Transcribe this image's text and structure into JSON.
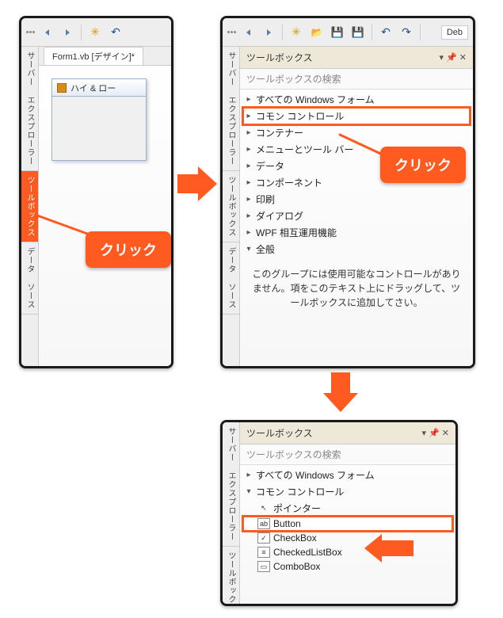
{
  "panel1": {
    "doc_tab": "Form1.vb [デザイン]*",
    "form_title": "ハイ & ロー",
    "vtabs": [
      "サーバー エクスプローラー",
      "ツールボックス",
      "データ ソース"
    ]
  },
  "panel2": {
    "config_text": "Deb",
    "vtabs": [
      "サーバー エクスプローラー",
      "ツールボックス",
      "データ ソース"
    ],
    "toolbox": {
      "title": "ツールボックス",
      "search_placeholder": "ツールボックスの検索",
      "categories": [
        "すべての Windows フォーム",
        "コモン コントロール",
        "コンテナー",
        "メニューとツール バー",
        "データ",
        "コンポーネント",
        "印刷",
        "ダイアログ",
        "WPF 相互運用機能",
        "全般"
      ],
      "empty_msg": "このグループには使用可能なコントロールがありません。項をこのテキスト上にドラッグして、ツールボックスに追加してさい。"
    }
  },
  "panel3": {
    "vtabs": [
      "サーバー エクスプローラー",
      "ツールボックス"
    ],
    "toolbox": {
      "title": "ツールボックス",
      "search_placeholder": "ツールボックスの検索",
      "cat_all": "すべての Windows フォーム",
      "cat_common": "コモン コントロール",
      "controls": [
        "ポインター",
        "Button",
        "CheckBox",
        "CheckedListBox",
        "ComboBox"
      ]
    }
  },
  "callouts": {
    "click1": "クリック",
    "click2": "クリック"
  }
}
